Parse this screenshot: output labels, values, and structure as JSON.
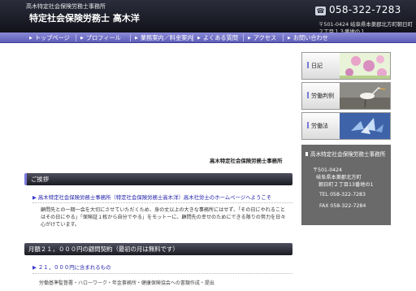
{
  "header": {
    "tagline": "高木特定社会保険労務士事務所",
    "site_name": "特定社会保険労務士 高木洋",
    "phone": "058-322-7283",
    "address": "〒501-0424 岐阜県本巣郡北方町朝日町２丁目１３番地の１"
  },
  "nav": {
    "items": [
      {
        "label": "トップページ"
      },
      {
        "label": "プロフィール"
      },
      {
        "label": "業務案内／料金案内"
      },
      {
        "label": "よくある質問"
      },
      {
        "label": "アクセス"
      },
      {
        "label": "お問い合わせ"
      }
    ]
  },
  "main": {
    "office_name": "高木特定社会保険労務士事務所",
    "greeting": {
      "heading": "ご挨拶",
      "link": "高木特定社会保険労務士事務所（特定社会保険労務士高木洋）高木社労士のホームページへようこそ",
      "body": "顧問先との一期一会を大切にさせていただくため、身の丈以上の大きな事務所にはせず、「その日にやれることはその日にやる」「保険証１枚から自分でやる」をモットーに、顧問先の幸せのためにできる限りの努力を日々心がけています。"
    },
    "contract": {
      "heading": "月額２１，０００円の顧問契約（最初の月は無料です）",
      "link": "２１，０００円に含まれるもの",
      "text": "労働基準監督署・ハローワーク・年金事務所・健康保険協会への書類作成・提出"
    }
  },
  "sidebar": {
    "buttons": [
      {
        "label": "日記"
      },
      {
        "label": "労働判例"
      },
      {
        "label": "労働法"
      }
    ],
    "info": {
      "title": "高木特定社会保険労務士事務所",
      "postal": "〒501-0424",
      "addr1": "岐阜県本巣郡北方町",
      "addr2": "朝日町２丁目13番地の1",
      "tel": "TEL 058-322-7283",
      "fax": "FAX 058-322-7284"
    }
  }
}
